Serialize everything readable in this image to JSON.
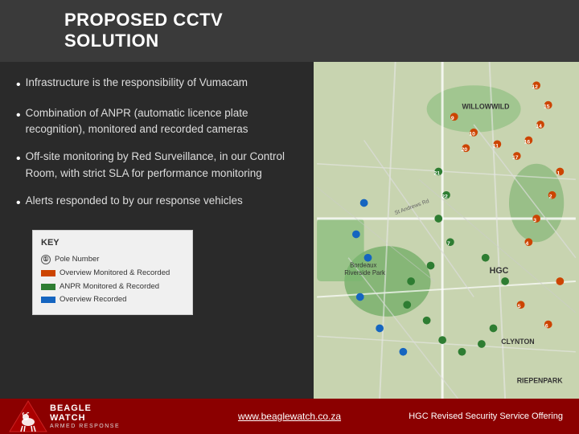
{
  "header": {
    "title_line1": "PROPOSED CCTV",
    "title_line2": "SOLUTION"
  },
  "bullets": [
    {
      "id": "b1",
      "text": "Infrastructure is the responsibility of Vumacam"
    },
    {
      "id": "b2",
      "text": "Combination of ANPR (automatic licence plate recognition), monitored and recorded cameras"
    },
    {
      "id": "b3",
      "text": "Off-site monitoring by Red Surveillance, in our Control Room, with strict SLA for performance monitoring"
    },
    {
      "id": "b4",
      "text": "Alerts responded to by our response vehicles"
    }
  ],
  "legend": {
    "title": "KEY",
    "items": [
      {
        "type": "circle",
        "label": "Pole Number",
        "color": "#333333"
      },
      {
        "type": "swatch",
        "label": "Overview Monitored & Recorded",
        "color": "#cc4400"
      },
      {
        "type": "swatch",
        "label": "ANPR Monitored & Recorded",
        "color": "#2e7d32"
      },
      {
        "type": "swatch",
        "label": "Overview Recorded",
        "color": "#1565c0"
      }
    ]
  },
  "map": {
    "labels": {
      "willowwild": "WILLOWWILD",
      "hgc": "HGC",
      "clynton": "CLYNTON",
      "riepenpark": "RIEPENPARK",
      "bordeux": "Bordeaux",
      "riverside": "Riverside Park"
    }
  },
  "footer": {
    "website": "www.beaglewatch.co.za",
    "tagline": "HGC Revised Security Service Offering",
    "logo_line1": "BEAGLE",
    "logo_line2": "WATCH",
    "logo_sub": "ARMED RESPONSE"
  }
}
